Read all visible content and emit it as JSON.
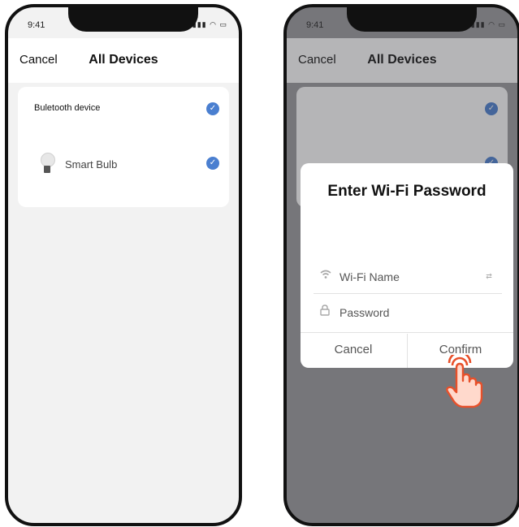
{
  "status_bar": {
    "time": "9:41",
    "icons": "▮▮▮ ◠ ▭"
  },
  "left_screen": {
    "cancel_label": "Cancel",
    "title": "All Devices",
    "section_label": "Buletooth device",
    "device_name": "Smart Bulb"
  },
  "right_screen": {
    "cancel_label": "Cancel",
    "title": "All Devices",
    "dialog": {
      "title": "Enter Wi-Fi Password",
      "wifi_name_label": "Wi-Fi Name",
      "password_label": "Password",
      "cancel_button": "Cancel",
      "confirm_button": "Confirm"
    }
  },
  "colors": {
    "accent": "#4a7fd0",
    "dim_overlay": "#9a9a9d",
    "hand_fill": "#ffd9cc",
    "hand_stroke": "#e8502a"
  },
  "icons": [
    "check-circle-icon",
    "bulb-icon",
    "wifi-icon",
    "lock-icon",
    "tap-hand-icon"
  ]
}
